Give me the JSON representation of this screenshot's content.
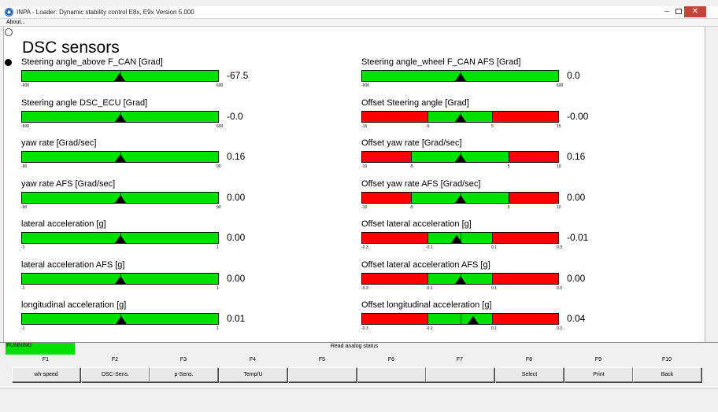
{
  "window": {
    "title": "INPA - Loader: Dynamic stability control E8x, E9x Version 5.000",
    "minimize_glyph": "–",
    "close_glyph": "✕",
    "icon": "inpa-app-icon"
  },
  "menu": {
    "about": "About..."
  },
  "page": {
    "heading": "DSC sensors"
  },
  "gauges": [
    {
      "id": "steering-angle-above-fcan",
      "label": "Steering angle_above F_CAN [Grad]",
      "value": "-67.5",
      "min": -600,
      "max": 600,
      "green_lo": -600,
      "green_hi": 600,
      "pointer": -3.3,
      "ticks": [
        "-600",
        "600"
      ],
      "tick_values": [
        -600,
        600
      ]
    },
    {
      "id": "steering-angle-wheel-fcan-afs",
      "label": "Steering angle_wheel F_CAN  AFS [Grad]",
      "value": "0.0",
      "min": -600,
      "max": 600,
      "green_lo": -600,
      "green_hi": 600,
      "pointer": 0,
      "ticks": [
        "-600",
        "600"
      ],
      "tick_values": [
        -600,
        600
      ]
    },
    {
      "id": "steering-angle-dsc-ecu",
      "label": "Steering angle DSC_ECU [Grad]",
      "value": "-0.0",
      "min": -600,
      "max": 600,
      "green_lo": -600,
      "green_hi": 600,
      "pointer": 0,
      "ticks": [
        "-600",
        "600"
      ],
      "tick_values": [
        -600,
        600
      ]
    },
    {
      "id": "offset-steering-angle",
      "label": "Offset Steering angle [Grad]",
      "value": "-0.00",
      "min": -15,
      "max": 15,
      "green_lo": -5,
      "green_hi": 5,
      "pointer": 0,
      "ticks": [
        "-15",
        "-5",
        "5",
        "15"
      ],
      "tick_values": [
        -15,
        -5,
        5,
        15
      ]
    },
    {
      "id": "yaw-rate",
      "label": "yaw rate [Grad/sec]",
      "value": "0.16",
      "min": -90,
      "max": 90,
      "green_lo": -90,
      "green_hi": 90,
      "pointer": 0,
      "ticks": [
        "-90",
        "90"
      ],
      "tick_values": [
        -90,
        90
      ]
    },
    {
      "id": "offset-yaw-rate",
      "label": "Offset yaw rate [Grad/sec]",
      "value": "0.16",
      "min": -10,
      "max": 10,
      "green_lo": -5,
      "green_hi": 5,
      "pointer": 0,
      "ticks": [
        "-10",
        "-5",
        "5",
        "10"
      ],
      "tick_values": [
        -10,
        -5,
        5,
        10
      ]
    },
    {
      "id": "yaw-rate-afs",
      "label": "yaw rate AFS [Grad/sec]",
      "value": "0.00",
      "min": -90,
      "max": 90,
      "green_lo": -90,
      "green_hi": 90,
      "pointer": 0,
      "ticks": [
        "-90",
        "90"
      ],
      "tick_values": [
        -90,
        90
      ]
    },
    {
      "id": "offset-yaw-rate-afs",
      "label": "Offset yaw rate AFS [Grad/sec]",
      "value": "0.00",
      "min": -10,
      "max": 10,
      "green_lo": -5,
      "green_hi": 5,
      "pointer": 0,
      "ticks": [
        "-10",
        "-5",
        "5",
        "10"
      ],
      "tick_values": [
        -10,
        -5,
        5,
        10
      ]
    },
    {
      "id": "lateral-acceleration",
      "label": "lateral acceleration [g]",
      "value": "0.00",
      "min": -1,
      "max": 1,
      "green_lo": -1,
      "green_hi": 1,
      "pointer": 0,
      "ticks": [
        "-1",
        "1"
      ],
      "tick_values": [
        -1,
        1
      ]
    },
    {
      "id": "offset-lateral-acceleration",
      "label": "Offset lateral acceleration [g]",
      "value": "-0.01",
      "min": -0.3,
      "max": 0.3,
      "green_lo": -0.1,
      "green_hi": 0.1,
      "pointer": -0.01,
      "ticks": [
        "-0.3",
        "-0.1",
        "0.1",
        "0.3"
      ],
      "tick_values": [
        -0.3,
        -0.1,
        0.1,
        0.3
      ]
    },
    {
      "id": "lateral-acceleration-afs",
      "label": "lateral acceleration AFS [g]",
      "value": "0.00",
      "min": -1,
      "max": 1,
      "green_lo": -1,
      "green_hi": 1,
      "pointer": 0,
      "ticks": [
        "-1",
        "1"
      ],
      "tick_values": [
        -1,
        1
      ]
    },
    {
      "id": "offset-lateral-acceleration-afs",
      "label": "Offset lateral acceleration AFS [g]",
      "value": "0.00",
      "min": -0.3,
      "max": 0.3,
      "green_lo": -0.1,
      "green_hi": 0.1,
      "pointer": 0,
      "ticks": [
        "-0.3",
        "-0.1",
        "0.1",
        "0.3"
      ],
      "tick_values": [
        -0.3,
        -0.1,
        0.1,
        0.3
      ]
    },
    {
      "id": "longitudinal-acceleration",
      "label": "longitudinal acceleration [g]",
      "value": "0.01",
      "min": -1,
      "max": 1,
      "green_lo": -1,
      "green_hi": 1,
      "pointer": 0.01,
      "ticks": [
        "-1",
        "1"
      ],
      "tick_values": [
        -1,
        1
      ]
    },
    {
      "id": "offset-longitudinal-acceleration",
      "label": "Offset longitudinal acceleration [g]",
      "value": "0.04",
      "min": -0.3,
      "max": 0.3,
      "green_lo": -0.1,
      "green_hi": 0.1,
      "pointer": 0.04,
      "ticks": [
        "-0.3",
        "-0.1",
        "0.1",
        "0.3"
      ],
      "tick_values": [
        -0.3,
        -0.1,
        0.1,
        0.3
      ]
    }
  ],
  "status": {
    "running": "RUNNING",
    "message": "Read analog status"
  },
  "fkeys": [
    {
      "key": "F1",
      "label": "wh-speed"
    },
    {
      "key": "F2",
      "label": "DSC-Sens."
    },
    {
      "key": "F3",
      "label": "p-Sens."
    },
    {
      "key": "F4",
      "label": "Temp/U"
    },
    {
      "key": "F5",
      "label": ""
    },
    {
      "key": "F6",
      "label": ""
    },
    {
      "key": "F7",
      "label": ""
    },
    {
      "key": "F8",
      "label": "Select"
    },
    {
      "key": "F9",
      "label": "Print"
    },
    {
      "key": "F10",
      "label": "Back"
    }
  ],
  "colors": {
    "ok": "#00e000",
    "alarm": "#ff0000",
    "pointer": "#000000"
  }
}
